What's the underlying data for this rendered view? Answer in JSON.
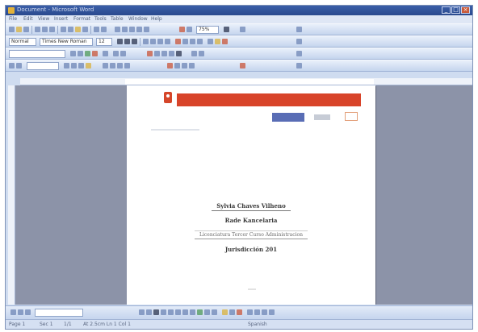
{
  "window": {
    "title": "Document - Microsoft Word",
    "accent_color": "#2a4a8e"
  },
  "menubar": {
    "items": [
      "File",
      "Edit",
      "View",
      "Insert",
      "Format",
      "Tools",
      "Table",
      "Window",
      "Help"
    ]
  },
  "toolbar": {
    "style_value": "Normal",
    "font_value": "Times New Roman",
    "size_value": "12",
    "zoom_value": "75%"
  },
  "document": {
    "line1": "Sylvia Chaves Vilheno",
    "line2": "Rade Kancelaria",
    "line3": "Licenciatura Tercer Curso Administracion",
    "line4": "Jurisdicción 201"
  },
  "statusbar": {
    "page": "Page 1",
    "section": "Sec 1",
    "page_of": "1/1",
    "position": "At 2.5cm  Ln 1  Col 1",
    "language": "Spanish"
  },
  "icons": {
    "window": [
      "app-icon",
      "minimize-icon",
      "maximize-icon",
      "close-icon"
    ]
  }
}
